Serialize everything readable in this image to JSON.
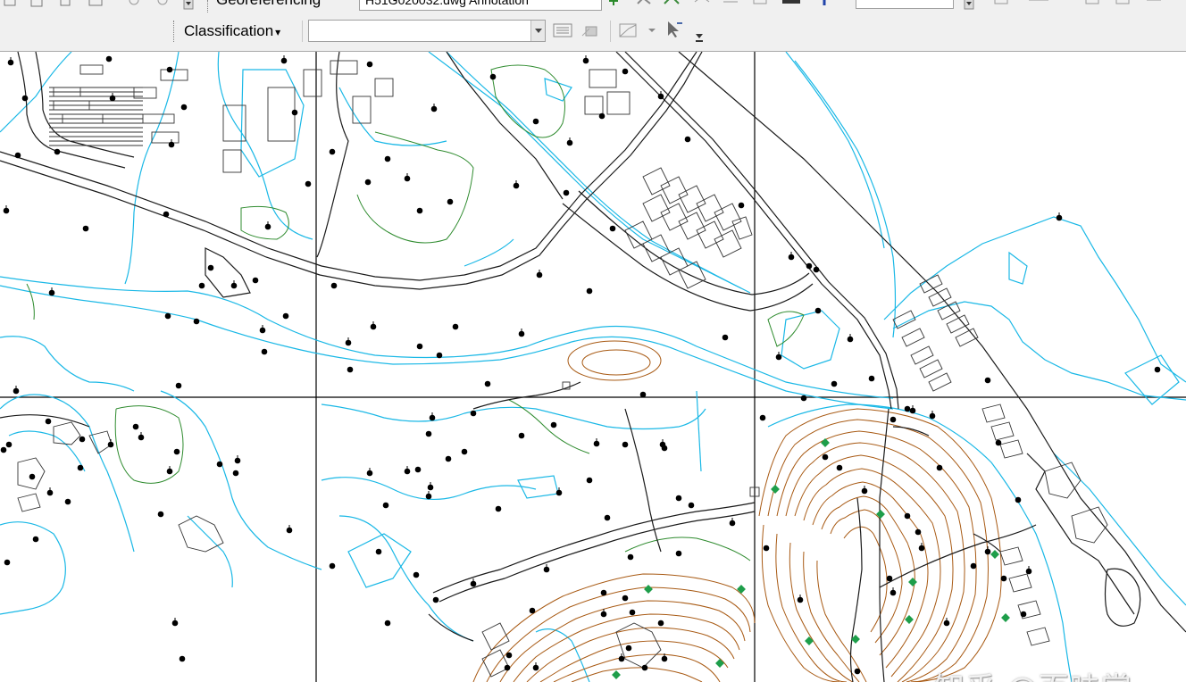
{
  "toolbar": {
    "georef_label": "Georeferencing",
    "layer_value": "H51G020032.dwg Annotation",
    "classification_label": "Classification",
    "classification_dropdown_arrow": "▾",
    "classification_combo_value": "",
    "icons": [
      "open-icon",
      "save-icon",
      "print-icon",
      "add-data-icon",
      "zoom-in-icon",
      "zoom-out-icon",
      "identify-icon",
      "layer-select-icon",
      "histogram-icon",
      "lock-icon",
      "line-tool-icon",
      "select-arrow-icon",
      "toolbar-overflow-icon"
    ]
  },
  "map": {
    "watermark": "知乎 @百味赏",
    "colors": {
      "roads": "#1a1a1a",
      "water": "#1ab8e6",
      "contours": "#a85a14",
      "vegetation": "#2e8b2e",
      "points": "#000000",
      "green_points": "#1e9e4a",
      "grid": "#000000"
    }
  }
}
